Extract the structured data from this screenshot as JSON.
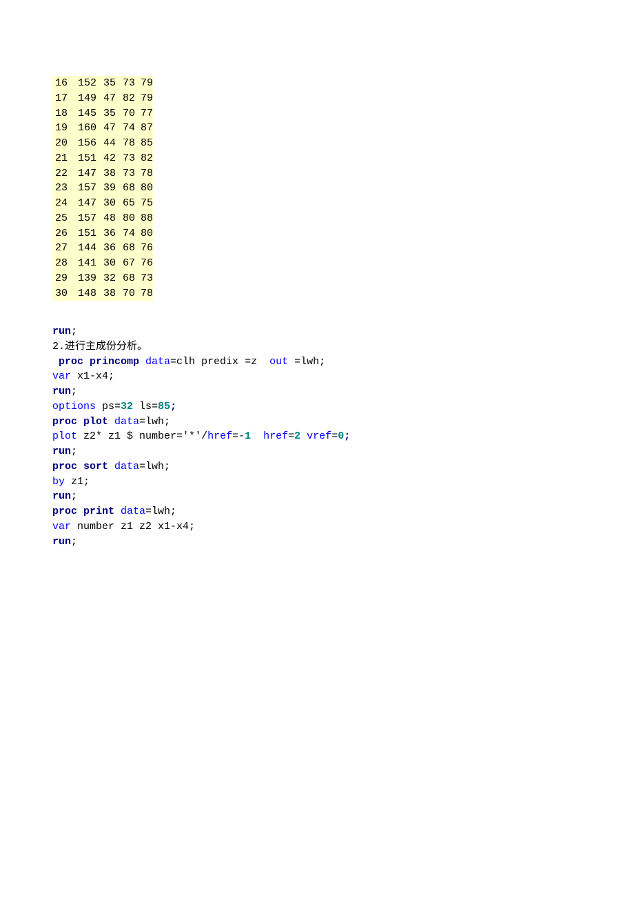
{
  "data_rows": [
    [
      "16",
      "152",
      "35",
      "73",
      "79"
    ],
    [
      "17",
      "149",
      "47",
      "82",
      "79"
    ],
    [
      "18",
      "145",
      "35",
      "70",
      "77"
    ],
    [
      "19",
      "160",
      "47",
      "74",
      "87"
    ],
    [
      "20",
      "156",
      "44",
      "78",
      "85"
    ],
    [
      "21",
      "151",
      "42",
      "73",
      "82"
    ],
    [
      "22",
      "147",
      "38",
      "73",
      "78"
    ],
    [
      "23",
      "157",
      "39",
      "68",
      "80"
    ],
    [
      "24",
      "147",
      "30",
      "65",
      "75"
    ],
    [
      "25",
      "157",
      "48",
      "80",
      "88"
    ],
    [
      "26",
      "151",
      "36",
      "74",
      "80"
    ],
    [
      "27",
      "144",
      "36",
      "68",
      "76"
    ],
    [
      "28",
      "141",
      "30",
      "67",
      "76"
    ],
    [
      "29",
      "139",
      "32",
      "68",
      "73"
    ],
    [
      "30",
      "148",
      "38",
      "70",
      "78"
    ]
  ],
  "code": {
    "run": "run",
    "semicolon": ";",
    "comment_line": "2.进行主成份分析。",
    "proc_princomp": " proc princomp",
    "data_eq": " data",
    "eq_clh": "=clh predix =z ",
    "out_kw": " out",
    "out_val": " =lwh;",
    "var_x1x4": "var",
    "var_x1x4_txt": " x1-x4;",
    "options_kw": "options",
    "ps_txt": " ps=",
    "ps_val": "32",
    "ls_txt": " ls=",
    "ls_val": "85",
    "proc_plot": "proc plot",
    "data_lwh": " data",
    "eq_lwh": "=lwh;",
    "plot_kw": "plot",
    "plot_txt1": " z2* z1 $ number=",
    "star_quote": "'*'",
    "slash": "/",
    "href1": "href",
    "eq_neg1_pre": "=-",
    "neg1": "1",
    "href2": "  href",
    "eq2": "=",
    "two": "2",
    "vref": " vref",
    "eq0": "=",
    "zero": "0",
    "proc_sort": "proc sort",
    "by_kw": "by",
    "by_txt": " z1;",
    "proc_print": "proc print",
    "var_kw2": "var",
    "var_txt2": " number z1 z2 x1-x4;"
  }
}
